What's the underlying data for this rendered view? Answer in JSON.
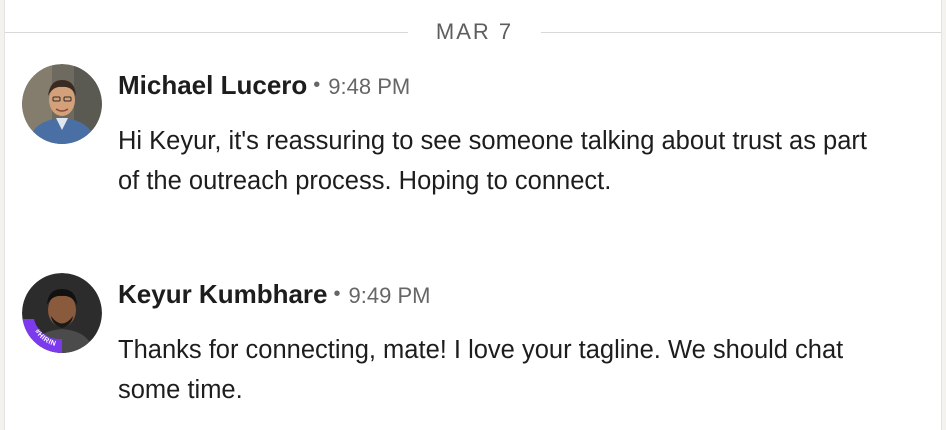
{
  "thread": {
    "date_divider": "MAR 7",
    "messages": [
      {
        "sender": "Michael Lucero",
        "separator": "•",
        "time": "9:48 PM",
        "text": "Hi Keyur, it's reassuring to see someone talking about trust as part of the outreach process. Hoping to connect.",
        "avatar_badge": ""
      },
      {
        "sender": "Keyur Kumbhare",
        "separator": "•",
        "time": "9:49 PM",
        "text": "Thanks for connecting, mate! I love your tagline. We should chat some time.",
        "avatar_badge": "#HIRING"
      }
    ]
  },
  "colors": {
    "hiring_ring": "#7c3aed",
    "name_text": "#1d1d1d",
    "meta_text": "#666666"
  }
}
